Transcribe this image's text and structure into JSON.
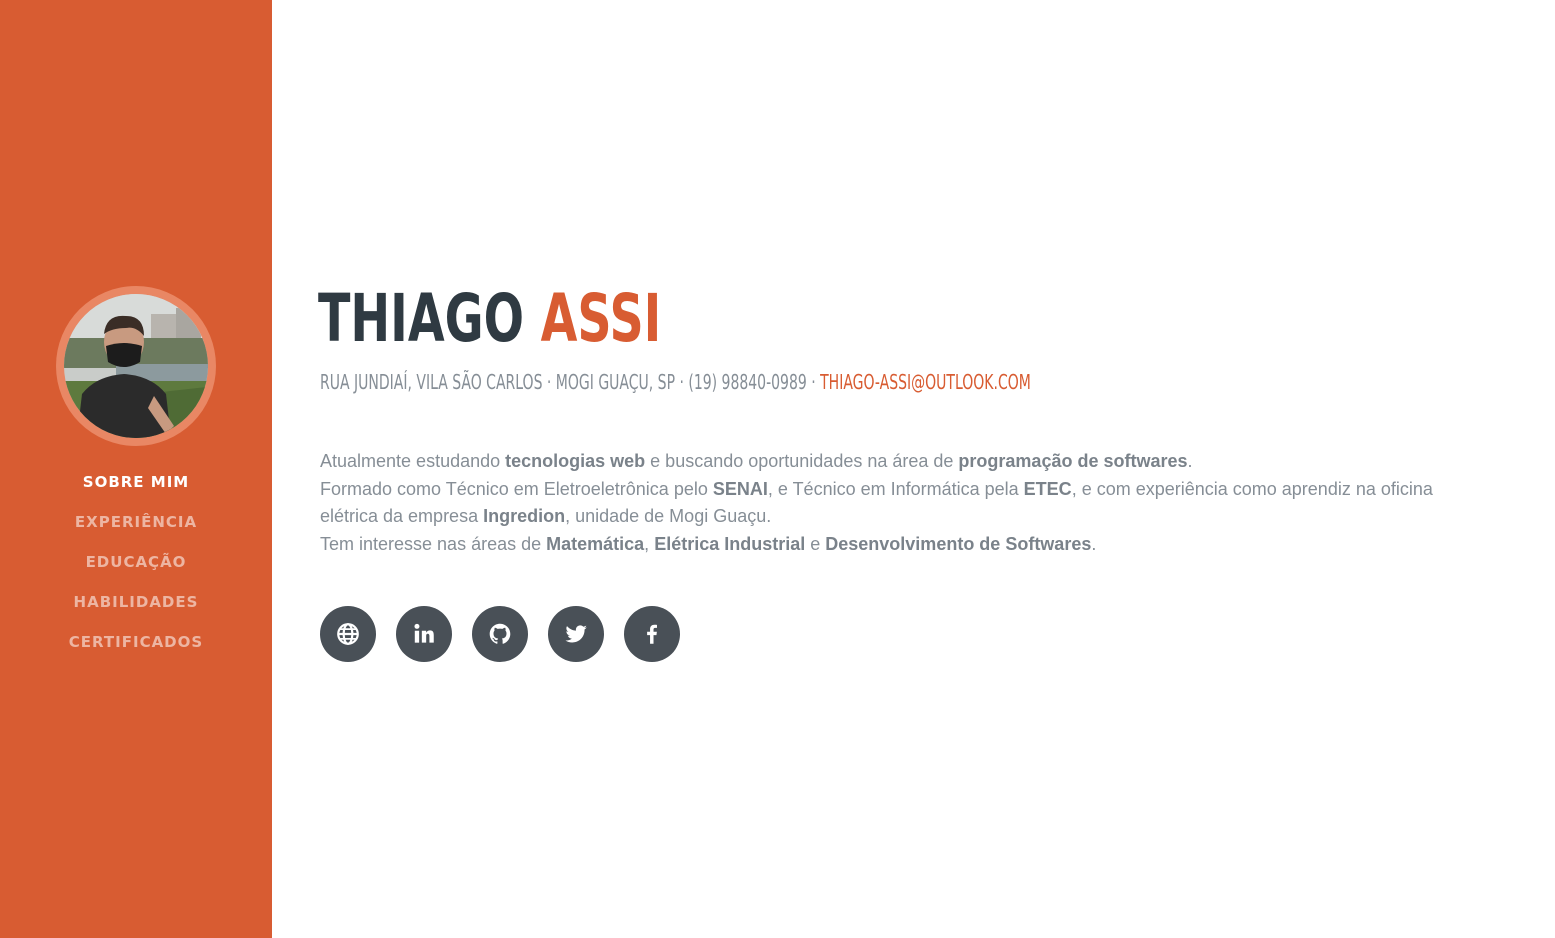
{
  "nav": {
    "items": [
      {
        "label": "SOBRE MIM"
      },
      {
        "label": "EXPERIÊNCIA"
      },
      {
        "label": "EDUCAÇÃO"
      },
      {
        "label": "HABILIDADES"
      },
      {
        "label": "CERTIFICADOS"
      }
    ],
    "active_index": 0
  },
  "profile": {
    "first_name": "THIAGO",
    "last_name": "ASSI",
    "address": "RUA JUNDIAÍ, VILA SÃO CARLOS · MOGI GUAÇU, SP · (19) 98840-0989 ·",
    "email": "THIAGO-ASSI@OUTLOOK.COM"
  },
  "about": {
    "line1": {
      "t1": "Atualmente estudando ",
      "b1": "tecnologias web",
      "t2": " e buscando oportunidades na área de ",
      "b2": "programação de softwares",
      "t3": "."
    },
    "line2": {
      "t1": "Formado como Técnico em Eletroeletrônica pelo ",
      "b1": "SENAI",
      "t2": ", e Técnico em Informática pela ",
      "b2": "ETEC",
      "t3": ", e com experiência como aprendiz na oficina elétrica da empresa ",
      "b3": "Ingredion",
      "t4": ", unidade de Mogi Guaçu."
    },
    "line3": {
      "t1": "Tem interesse nas áreas de ",
      "b1": "Matemática",
      "t2": ", ",
      "b2": "Elétrica Industrial",
      "t3": " e ",
      "b3": "Desenvolvimento de Softwares",
      "t4": "."
    }
  },
  "social": [
    {
      "icon": "globe-icon"
    },
    {
      "icon": "linkedin-icon"
    },
    {
      "icon": "github-icon"
    },
    {
      "icon": "twitter-icon"
    },
    {
      "icon": "facebook-icon"
    }
  ],
  "colors": {
    "primary": "#d85c32",
    "dark": "#2f3a42",
    "muted": "#868e96",
    "button": "#495057"
  }
}
